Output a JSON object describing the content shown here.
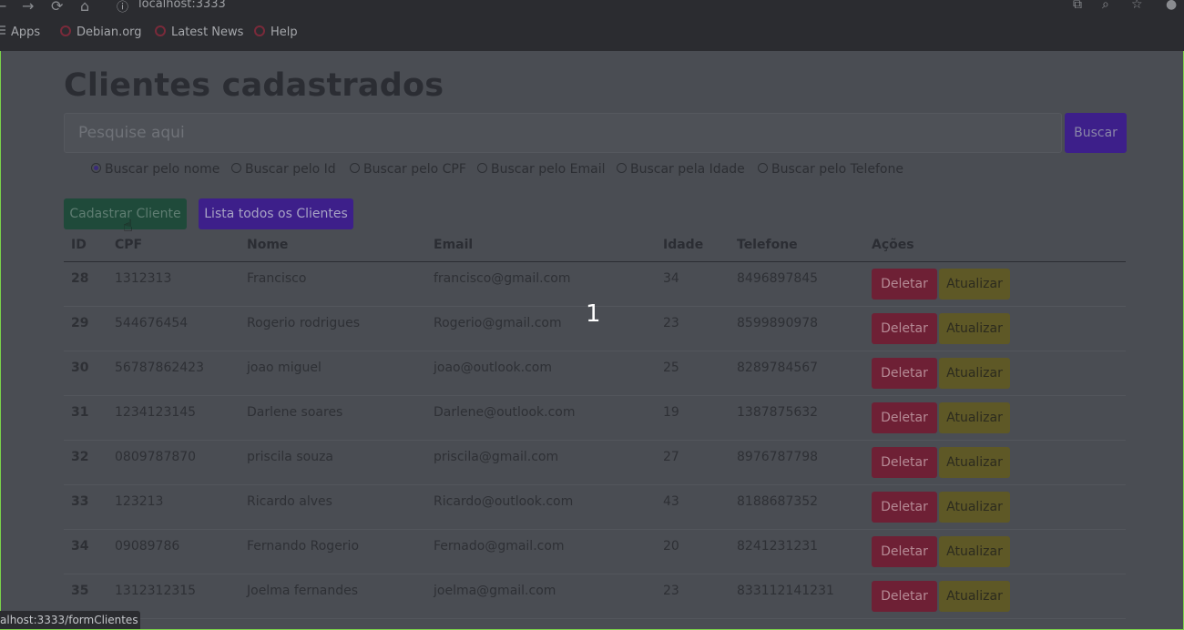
{
  "browser": {
    "url": "localhost:3333",
    "bookmarks": [
      "Apps",
      "Debian.org",
      "Latest News",
      "Help"
    ],
    "status_url": "alhost:3333/formClientes"
  },
  "page": {
    "title": "Clientes cadastrados",
    "search_placeholder": "Pesquise aqui",
    "search_button": "Buscar",
    "radios": [
      {
        "label": "Buscar pelo nome",
        "checked": true
      },
      {
        "label": "Buscar pelo Id",
        "checked": false
      },
      {
        "label": "Buscar pelo CPF",
        "checked": false
      },
      {
        "label": "Buscar pelo Email",
        "checked": false
      },
      {
        "label": "Buscar pela Idade",
        "checked": false
      },
      {
        "label": "Buscar pelo Telefone",
        "checked": false
      }
    ],
    "cadastrar_button": "Cadastrar Cliente",
    "lista_button": "Lista todos os Clientes",
    "overlay_number": "1"
  },
  "table": {
    "headers": [
      "ID",
      "CPF",
      "Nome",
      "Email",
      "Idade",
      "Telefone",
      "Ações"
    ],
    "delete_label": "Deletar",
    "update_label": "Atualizar",
    "rows": [
      {
        "id": "28",
        "cpf": "1312313",
        "nome": "Francisco",
        "email": "francisco@gmail.com",
        "idade": "34",
        "telefone": "8496897845"
      },
      {
        "id": "29",
        "cpf": "544676454",
        "nome": "Rogerio rodrigues",
        "email": "Rogerio@gmail.com",
        "idade": "23",
        "telefone": "8599890978"
      },
      {
        "id": "30",
        "cpf": "56787862423",
        "nome": "joao miguel",
        "email": "joao@outlook.com",
        "idade": "25",
        "telefone": "8289784567"
      },
      {
        "id": "31",
        "cpf": "1234123145",
        "nome": "Darlene soares",
        "email": "Darlene@outlook.com",
        "idade": "19",
        "telefone": "1387875632"
      },
      {
        "id": "32",
        "cpf": "0809787870",
        "nome": "priscila souza",
        "email": "priscila@gmail.com",
        "idade": "27",
        "telefone": "8976787798"
      },
      {
        "id": "33",
        "cpf": "123213",
        "nome": "Ricardo alves",
        "email": "Ricardo@outlook.com",
        "idade": "43",
        "telefone": "8188687352"
      },
      {
        "id": "34",
        "cpf": "09089786",
        "nome": "Fernando Rogerio",
        "email": "Fernado@gmail.com",
        "idade": "20",
        "telefone": "8241231231"
      },
      {
        "id": "35",
        "cpf": "1312312315",
        "nome": "Joelma fernandes",
        "email": "joelma@gmail.com",
        "idade": "23",
        "telefone": "833112141231"
      }
    ]
  },
  "colors": {
    "buscar": "#3d1f8a",
    "cadastrar": "#1f4a3a",
    "deletar": "#6e2035",
    "atualizar": "#5e5826"
  },
  "icons": [
    "back-arrow-icon",
    "forward-arrow-icon",
    "reload-icon",
    "home-icon",
    "info-icon",
    "translate-icon",
    "zoom-icon",
    "star-icon",
    "profile-icon",
    "pointer-cursor-icon"
  ]
}
